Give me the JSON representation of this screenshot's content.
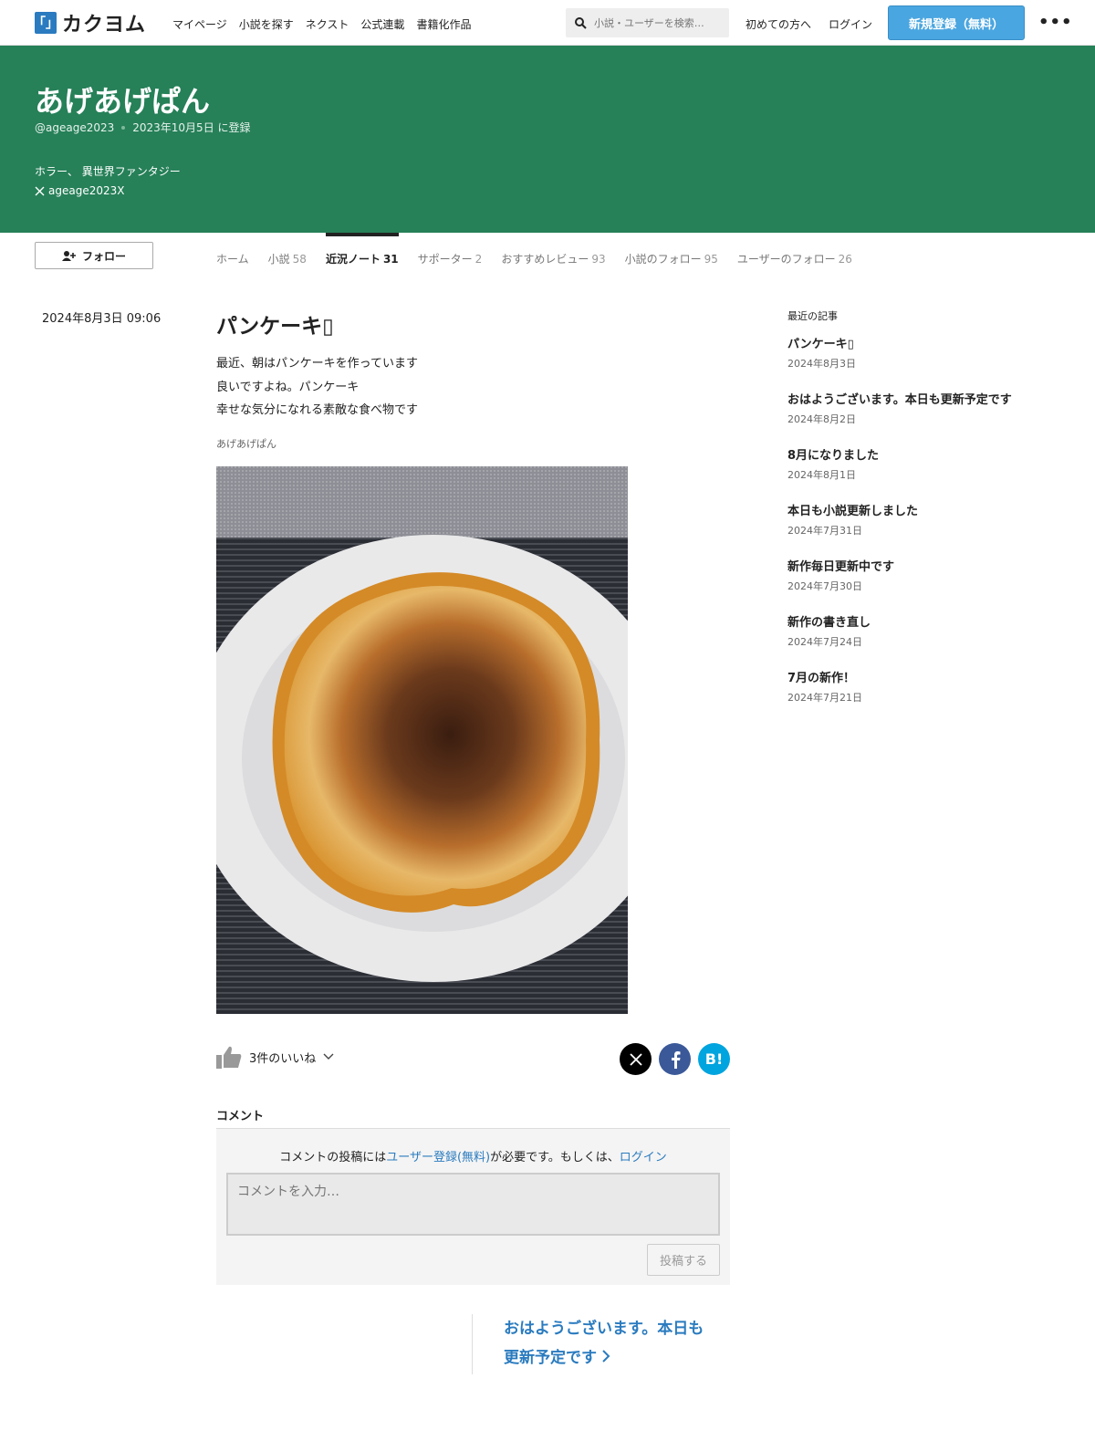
{
  "header": {
    "logo_mark": "「」",
    "logo_text": "カクヨム",
    "nav": [
      "マイページ",
      "小説を探す",
      "ネクスト",
      "公式連載",
      "書籍化作品"
    ],
    "search_placeholder": "小説・ユーザーを検索…",
    "first_time": "初めての方へ",
    "login": "ログイン",
    "signup": "新規登録（無料）",
    "more": "•••"
  },
  "profile": {
    "name": "あげあげぱん",
    "handle": "@ageage2023",
    "registered": "2023年10月5日 に登録",
    "genres": "ホラー、 異世界ファンタジー",
    "x_account": "ageage2023X",
    "follow_label": "フォロー"
  },
  "tabs": [
    {
      "label": "ホーム",
      "count": ""
    },
    {
      "label": "小説",
      "count": "58"
    },
    {
      "label": "近況ノート",
      "count": "31"
    },
    {
      "label": "サポーター",
      "count": "2"
    },
    {
      "label": "おすすめレビュー",
      "count": "93"
    },
    {
      "label": "小説のフォロー",
      "count": "95"
    },
    {
      "label": "ユーザーのフォロー",
      "count": "26"
    }
  ],
  "post": {
    "date": "2024年8月3日 09:06",
    "title": "パンケーキ▯",
    "body": [
      "最近、朝はパンケーキを作っています",
      "良いですよね。パンケーキ",
      "幸せな気分になれる素敵な食べ物です"
    ],
    "author": "あげあげぱん",
    "likes": "3件のいいね",
    "share": {
      "hatena": "B!"
    }
  },
  "comment": {
    "heading": "コメント",
    "notice_pre": "コメントの投稿には",
    "notice_link1": "ユーザー登録(無料)",
    "notice_mid": "が必要です。もしくは、",
    "notice_link2": "ログイン",
    "placeholder": "コメントを入力…",
    "submit": "投稿する"
  },
  "next_post": {
    "line1": "おはようございます。本日も",
    "line2": "更新予定です"
  },
  "sidebar": {
    "heading": "最近の記事",
    "items": [
      {
        "title": "パンケーキ▯",
        "date": "2024年8月3日"
      },
      {
        "title": "おはようございます。本日も更新予定です",
        "date": "2024年8月2日"
      },
      {
        "title": "8月になりました",
        "date": "2024年8月1日"
      },
      {
        "title": "本日も小説更新しました",
        "date": "2024年7月31日"
      },
      {
        "title": "新作毎日更新中です",
        "date": "2024年7月30日"
      },
      {
        "title": "新作の書き直し",
        "date": "2024年7月24日"
      },
      {
        "title": "7月の新作！",
        "date": "2024年7月21日"
      }
    ]
  },
  "colors": {
    "banner": "#268058",
    "accent": "#2a7bbf",
    "signup": "#4aa6e0"
  }
}
